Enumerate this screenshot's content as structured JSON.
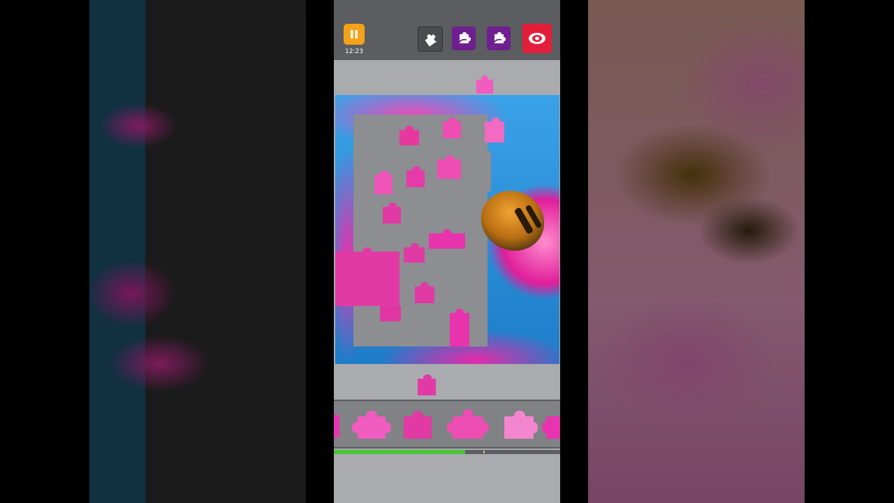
{
  "game": {
    "timer": "12:23",
    "progress_fraction": 0.58,
    "accent_colors": {
      "pause": "#f5a11a",
      "edge_tool": "#6f1f8f",
      "preview": "#e41e3a",
      "progress": "#4cc23a",
      "piece": "#e834b0"
    }
  },
  "toolbar": {
    "pause_icon": "pause-icon",
    "tools": [
      {
        "name": "piece-sort-icon"
      },
      {
        "name": "edge-pieces-icon"
      },
      {
        "name": "edge-pieces-alt-icon"
      },
      {
        "name": "preview-eye-icon"
      }
    ]
  },
  "tray": {
    "piece_count_visible": 6
  }
}
